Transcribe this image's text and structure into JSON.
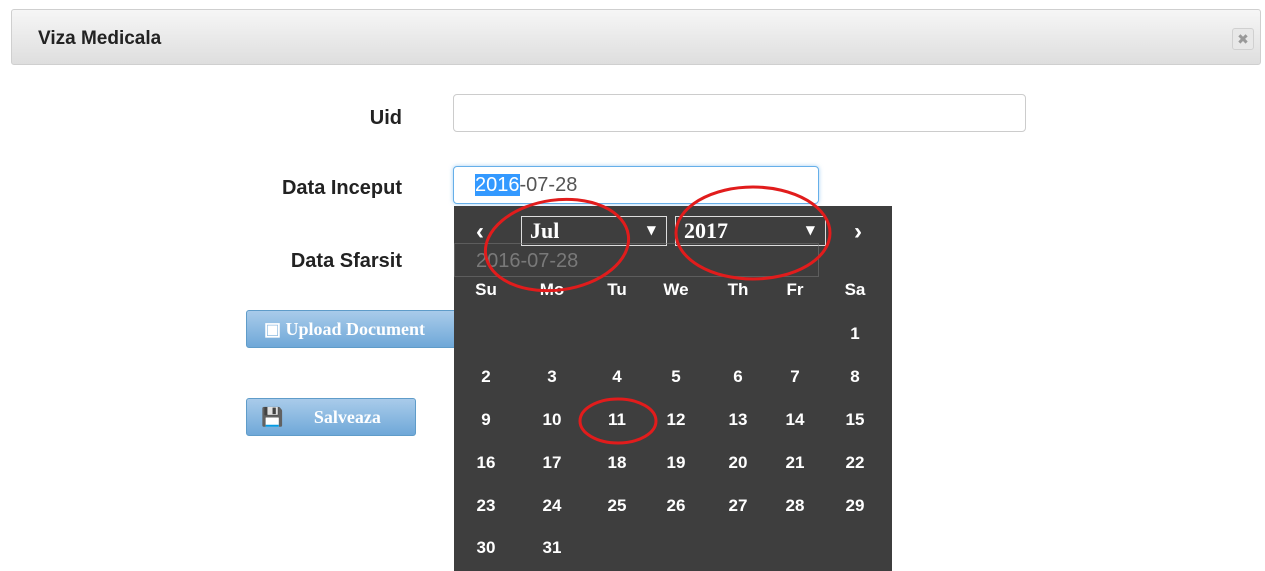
{
  "modal": {
    "title": "Viza Medicala",
    "close_symbol": "✖"
  },
  "form": {
    "uid_label": "Uid",
    "uid_value": "",
    "start_label": "Data Inceput",
    "start_value_selected": "2016",
    "start_value_rest": "-07-28",
    "end_label": "Data Sfarsit",
    "end_value_ghost": "2016-07-28",
    "upload_label": "Upload Document",
    "save_label": "Salveaza"
  },
  "datepicker": {
    "month": "Jul",
    "year": "2017",
    "prev_symbol": "‹",
    "next_symbol": "›",
    "weekdays": [
      "Su",
      "Mo",
      "Tu",
      "We",
      "Th",
      "Fr",
      "Sa"
    ],
    "weeks": [
      [
        "",
        "",
        "",
        "",
        "",
        "",
        "1"
      ],
      [
        "2",
        "3",
        "4",
        "5",
        "6",
        "7",
        "8"
      ],
      [
        "9",
        "10",
        "11",
        "12",
        "13",
        "14",
        "15"
      ],
      [
        "16",
        "17",
        "18",
        "19",
        "20",
        "21",
        "22"
      ],
      [
        "23",
        "24",
        "25",
        "26",
        "27",
        "28",
        "29"
      ],
      [
        "30",
        "31",
        "",
        "",
        "",
        "",
        ""
      ]
    ]
  },
  "colors": {
    "accent": "#3399ff",
    "annotation": "#e11c1c",
    "picker_bg": "#3e3e3e"
  }
}
